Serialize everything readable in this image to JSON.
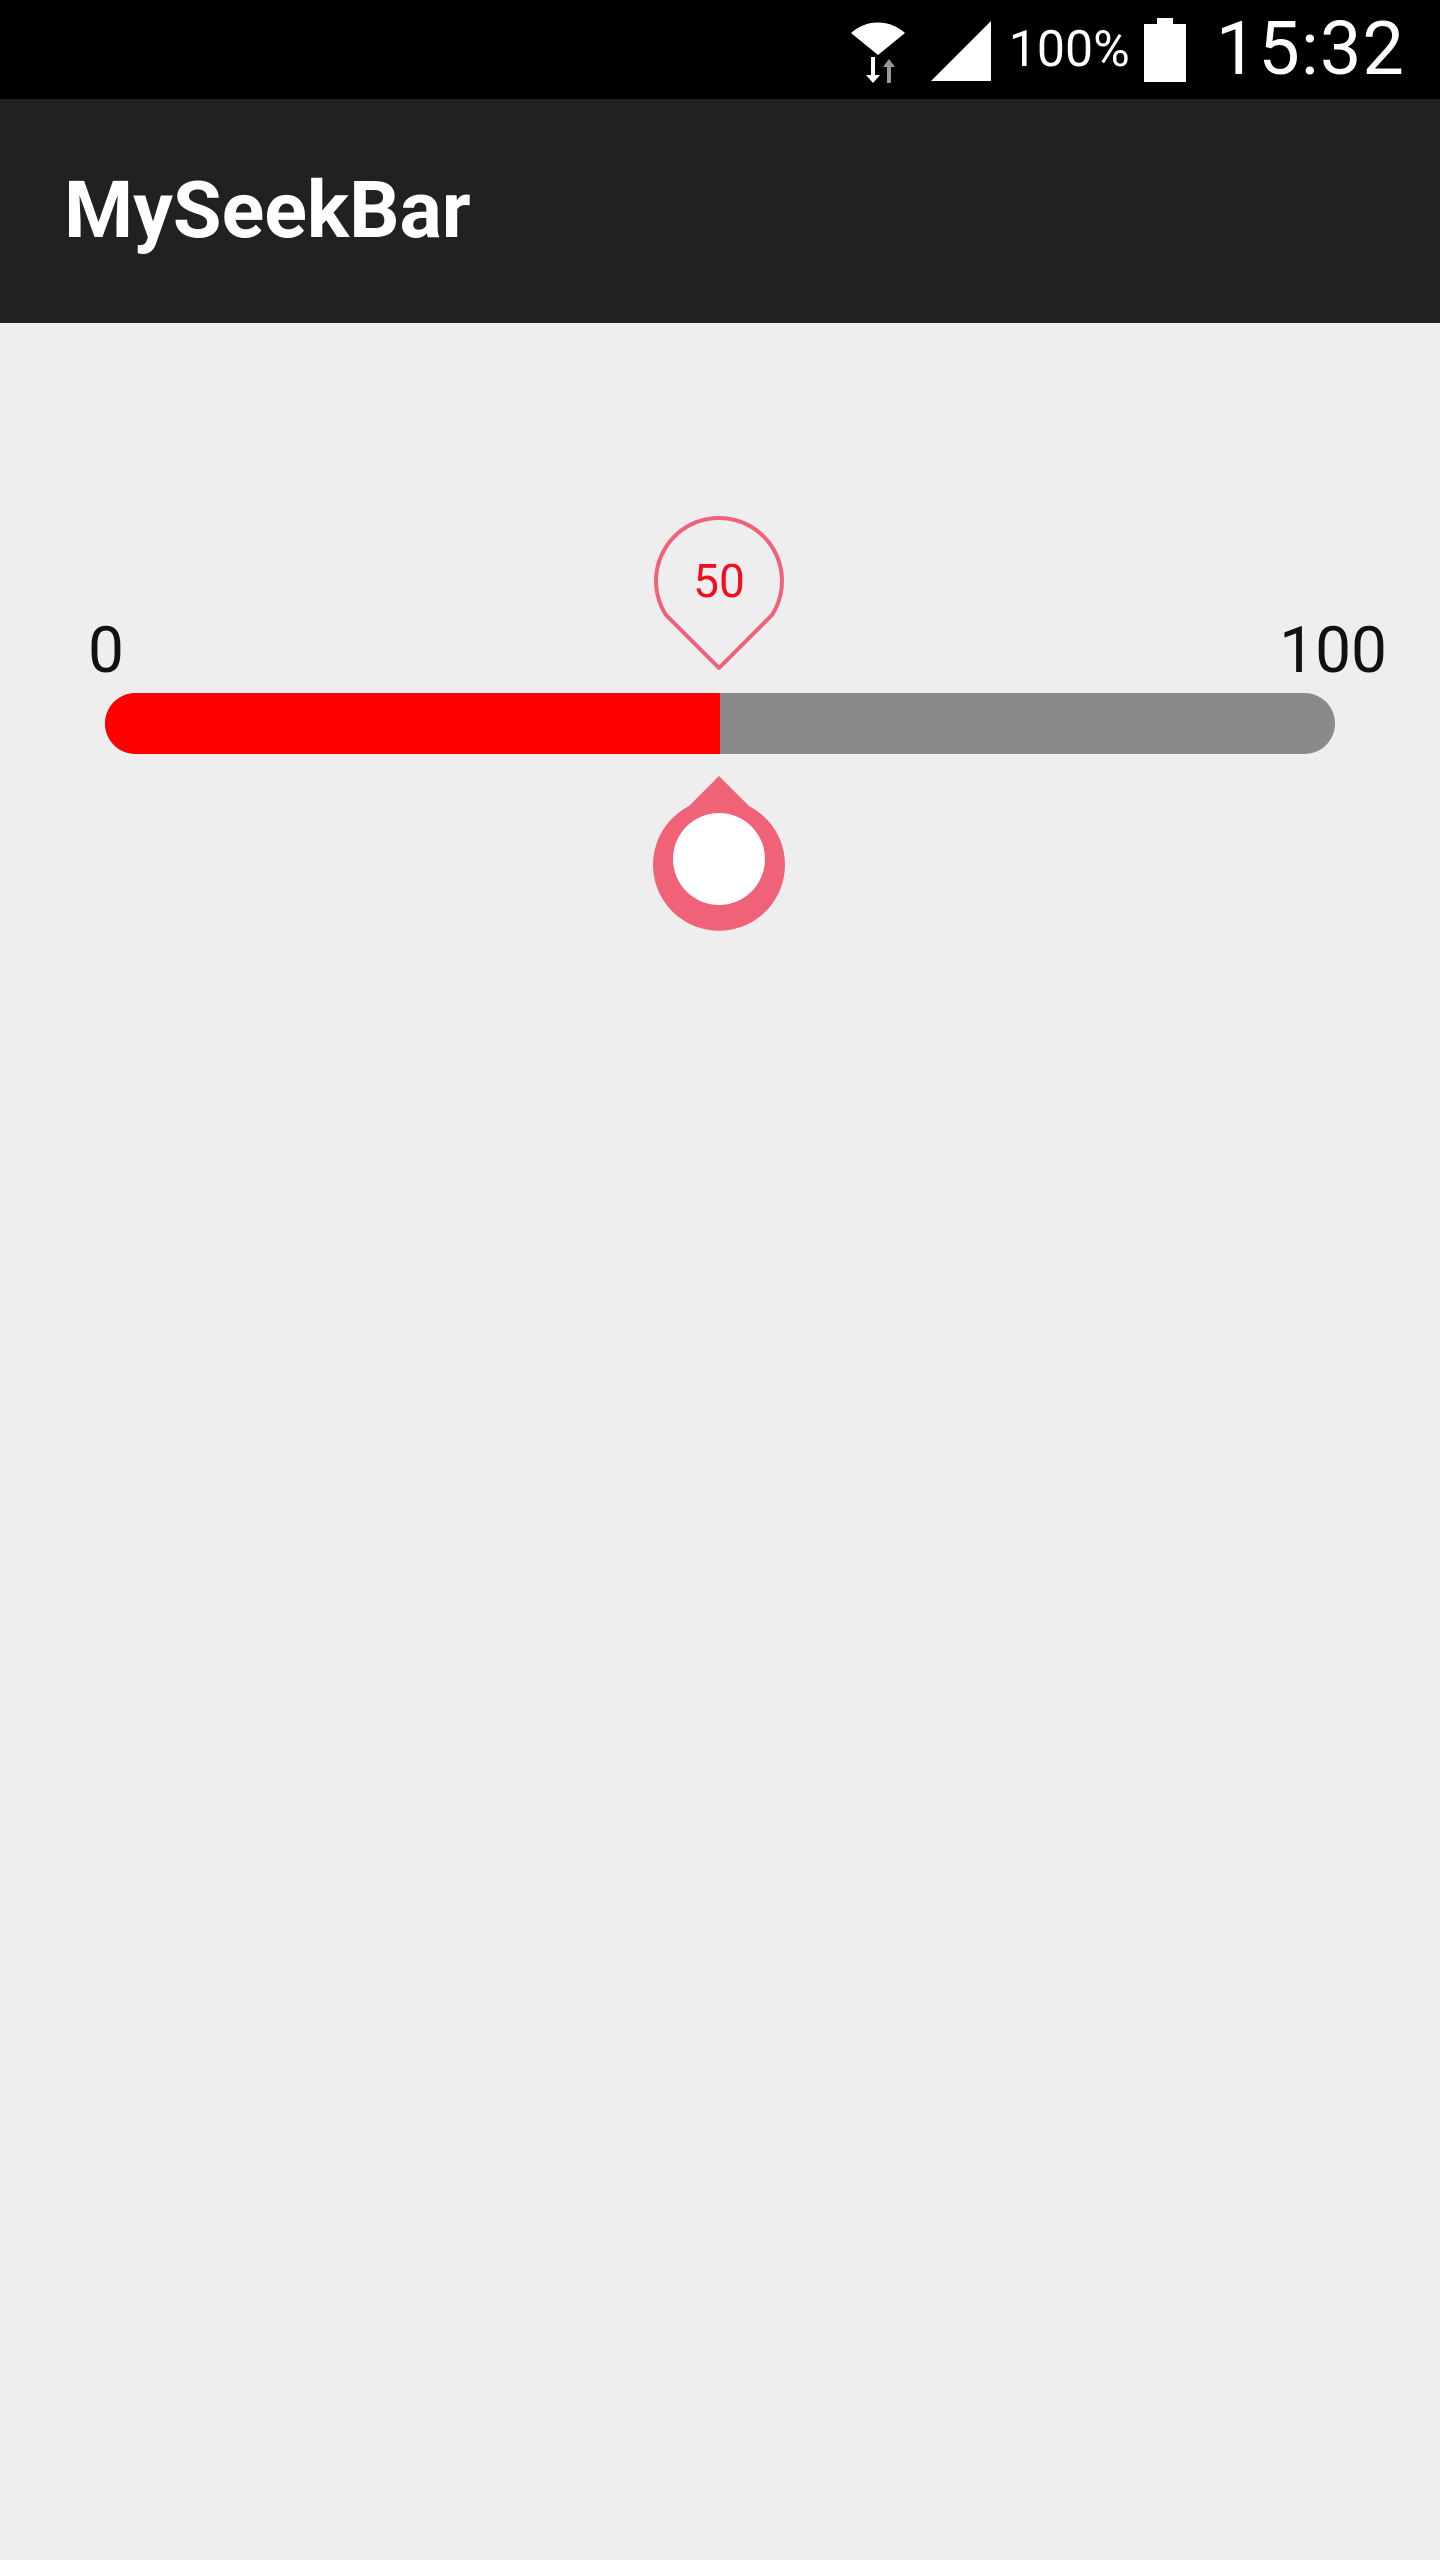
{
  "status_bar": {
    "icons": [
      "wifi-icon",
      "signal-icon",
      "battery-icon"
    ],
    "battery_percent": "100%",
    "time": "15:32"
  },
  "app_bar": {
    "title": "MySeekBar"
  },
  "seekbar": {
    "min_label": "0",
    "max_label": "100",
    "value": 50,
    "value_label": "50",
    "progress_color": "#ff0000",
    "track_color": "#8a8a8a",
    "accent_color": "#f06278",
    "value_text_color": "#ee1122"
  }
}
